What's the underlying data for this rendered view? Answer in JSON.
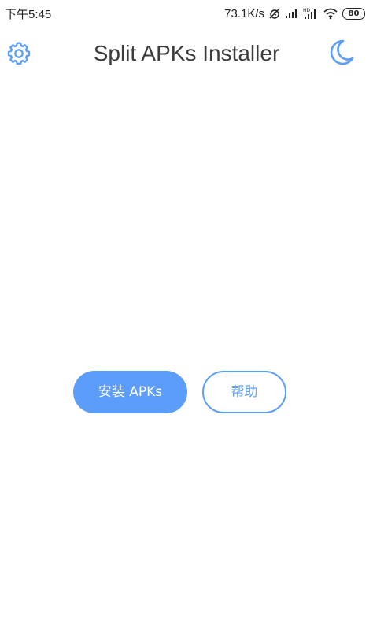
{
  "status_bar": {
    "time": "下午5:45",
    "net_speed": "73.1K/s",
    "battery": "80",
    "icons": [
      "alarm-off-icon",
      "signal-icon",
      "hd-signal-icon",
      "wifi-icon",
      "battery-icon"
    ]
  },
  "app_bar": {
    "title": "Split APKs Installer",
    "settings_icon": "gear-icon",
    "theme_icon": "moon-icon"
  },
  "actions": {
    "install_label": "安装 APKs",
    "help_label": "帮助"
  },
  "colors": {
    "accent": "#5b9df9",
    "title": "#3c3c3c",
    "background": "#ffffff"
  }
}
